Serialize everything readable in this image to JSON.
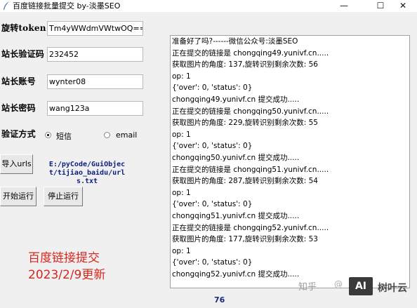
{
  "window": {
    "title": "百度链接批量提交 by-淡墨SEO",
    "minimize": "—",
    "maximize": "☐",
    "close": "✕"
  },
  "form": {
    "token_label": "旋转token",
    "token_value": "Tm4yWWdmVWtwOQ==",
    "code_label": "站长验证码",
    "code_value": "232452",
    "account_label": "站长账号",
    "account_value": "wynter08",
    "password_label": "站长密码",
    "password_value": "wang123a",
    "verify_label": "验证方式",
    "verify_options": [
      "短信",
      "email"
    ],
    "verify_selected": "短信"
  },
  "buttons": {
    "import": "导入urls",
    "start": "开始运行",
    "stop": "停止运行"
  },
  "file_path": "E:/pyCode/GuiObject/tijiao_baidu/urls.txt",
  "log_lines": [
    "准备好了吗?------微信公众号:淡墨SEO",
    "正在提交的链接是 chongqing49.yunivf.cn.....",
    "获取图片的角度: 137,旋转识别剩余次数: 56",
    "op: 1",
    "{'over': 0, 'status': 0}",
    "chongqing49.yunivf.cn 提交成功.....",
    "正在提交的链接是 chongqing50.yunivf.cn.....",
    "获取图片的角度: 229,旋转识别剩余次数: 55",
    "op: 1",
    "{'over': 0, 'status': 0}",
    "chongqing50.yunivf.cn 提交成功.....",
    "正在提交的链接是 chongqing51.yunivf.cn.....",
    "获取图片的角度: 287,旋转识别剩余次数: 54",
    "op: 1",
    "{'over': 0, 'status': 0}",
    "chongqing51.yunivf.cn 提交成功.....",
    "正在提交的链接是 chongqing52.yunivf.cn.....",
    "获取图片的角度: 177,旋转识别剩余次数: 53",
    "op: 1",
    "{'over': 0, 'status': 0}",
    "chongqing52.yunivf.cn 提交成功....."
  ],
  "promo": {
    "line1": "百度链接提交",
    "line2": "2023/2/9更新"
  },
  "counter": "76",
  "watermark": {
    "zhihu": "知乎",
    "logo": "AI",
    "brand": "树叶云"
  },
  "colors": {
    "promo_red": "#d6261f",
    "path_blue": "#0b1f7a"
  }
}
